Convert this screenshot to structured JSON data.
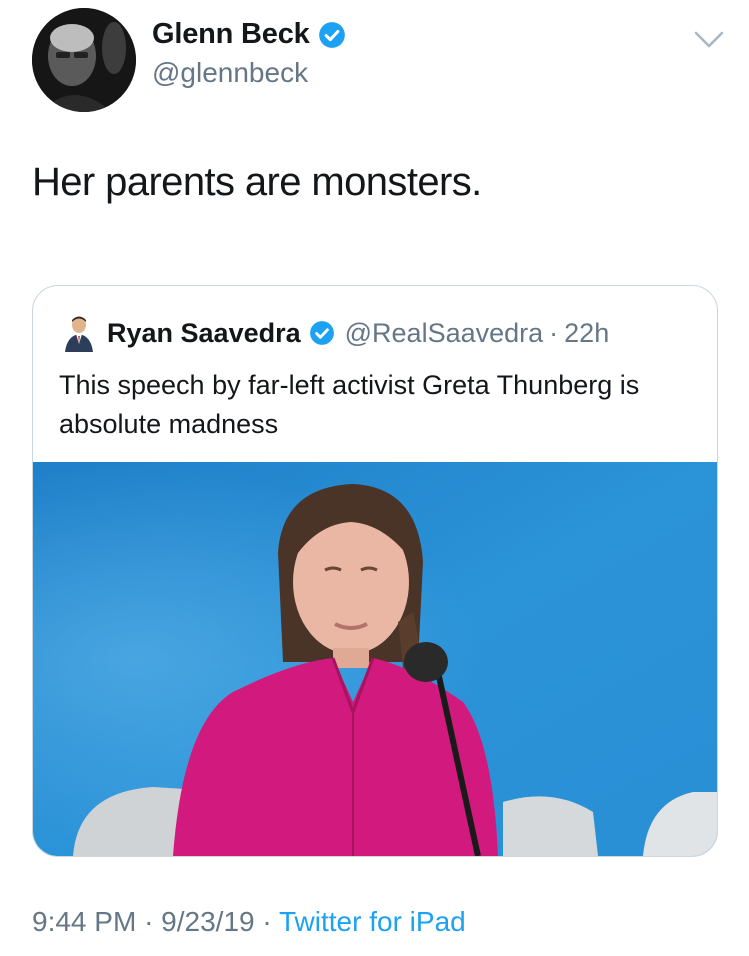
{
  "tweet": {
    "author": {
      "name": "Glenn Beck",
      "handle": "@glennbeck",
      "verified": true
    },
    "text": "Her parents are monsters.",
    "footer": {
      "time": "9:44 PM",
      "date": "9/23/19",
      "source": "Twitter for iPad",
      "separator": "·"
    }
  },
  "quoted_tweet": {
    "author": {
      "name": "Ryan Saavedra",
      "handle": "@RealSaavedra",
      "verified": true
    },
    "separator": "·",
    "age": "22h",
    "text": "This speech by far-left activist Greta Thunberg is absolute madness",
    "media": {
      "kind": "video-still",
      "subject": "girl in pink blouse speaking at microphone, blue background"
    }
  },
  "colors": {
    "text": "#14171a",
    "muted": "#657786",
    "accent": "#1da1f2",
    "border": "#ccd6dd"
  },
  "icons": {
    "verified": "verified-badge-icon",
    "menu": "chevron-down-icon"
  }
}
